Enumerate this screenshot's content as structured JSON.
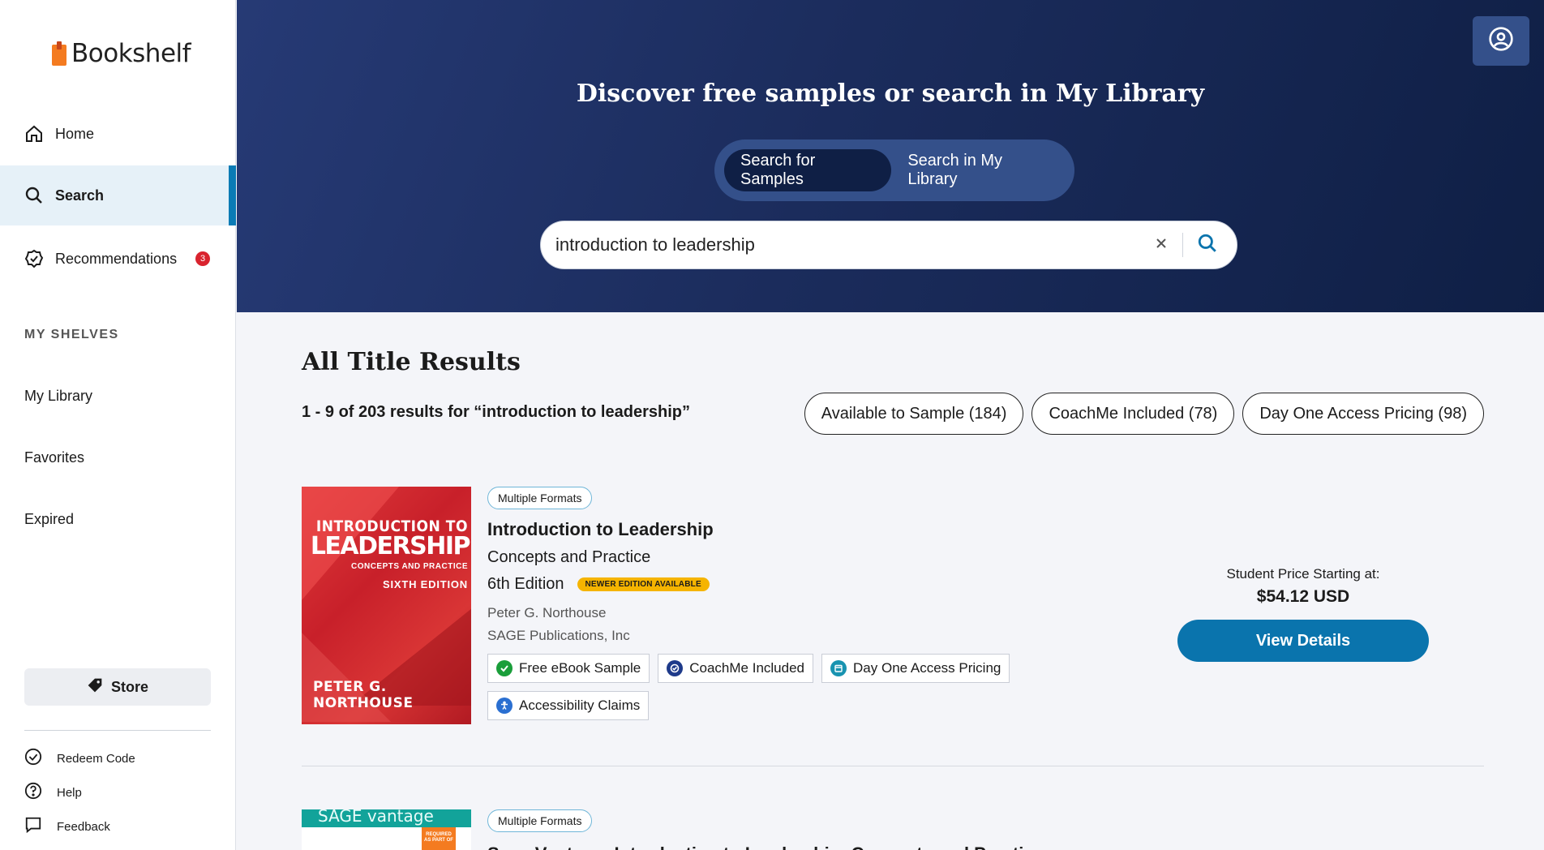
{
  "app": {
    "name": "Bookshelf"
  },
  "sidebar": {
    "nav": [
      {
        "label": "Home",
        "icon": "home-icon"
      },
      {
        "label": "Search",
        "icon": "search-icon",
        "active": true
      },
      {
        "label": "Recommendations",
        "icon": "badge-check-icon",
        "badge": "3"
      }
    ],
    "shelves_header": "MY SHELVES",
    "shelves": [
      "My Library",
      "Favorites",
      "Expired"
    ],
    "store_label": "Store",
    "footer": [
      {
        "label": "Redeem Code",
        "icon": "check-circle-icon"
      },
      {
        "label": "Help",
        "icon": "help-icon"
      },
      {
        "label": "Feedback",
        "icon": "chat-icon"
      }
    ]
  },
  "hero": {
    "title": "Discover free samples or search in My Library",
    "toggle": {
      "samples": "Search for Samples",
      "library": "Search in My Library",
      "selected": "Search for Samples"
    },
    "search": {
      "value": "introduction to leadership",
      "placeholder": ""
    }
  },
  "results": {
    "title": "All Title Results",
    "count_text": "1 - 9 of 203 results for “introduction to leadership”",
    "filters": [
      "Available to Sample (184)",
      "CoachMe Included (78)",
      "Day One Access Pricing (98)"
    ],
    "items": [
      {
        "format": "Multiple Formats",
        "title": "Introduction to Leadership",
        "subtitle": "Concepts and Practice",
        "edition": "6th Edition",
        "edition_badge": "NEWER EDITION AVAILABLE",
        "author": "Peter G. Northouse",
        "publisher": "SAGE Publications, Inc",
        "cover": {
          "line1": "INTRODUCTION TO",
          "line2": "LEADERSHIP",
          "line3": "CONCEPTS AND PRACTICE",
          "line4": "SIXTH EDITION",
          "author": "PETER G. NORTHOUSE"
        },
        "features": [
          {
            "label": "Free eBook Sample",
            "icon": "check-circle-icon",
            "color": "#1a9e3a"
          },
          {
            "label": "CoachMe Included",
            "icon": "coach-icon",
            "color": "#1e3a8a"
          },
          {
            "label": "Day One Access Pricing",
            "icon": "calendar-icon",
            "color": "#1893b0"
          },
          {
            "label": "Accessibility Claims",
            "icon": "accessibility-icon",
            "color": "#2a6fd1"
          }
        ],
        "price_label": "Student Price Starting at:",
        "price": "$54.12  USD",
        "cta": "View Details"
      },
      {
        "format": "Multiple Formats",
        "title": "Sage Vantage: Introduction to Leadership: Concepts and Practice",
        "cover": {
          "line1": "SAGE vantage",
          "line2": "REQUIRED AS PART OF"
        }
      }
    ]
  },
  "colors": {
    "accent": "#0a74ad",
    "hero_bg": "#1b2c5c",
    "badge_red": "#d9232e",
    "newer_badge": "#f5b400",
    "logo_orange": "#f47b20"
  }
}
